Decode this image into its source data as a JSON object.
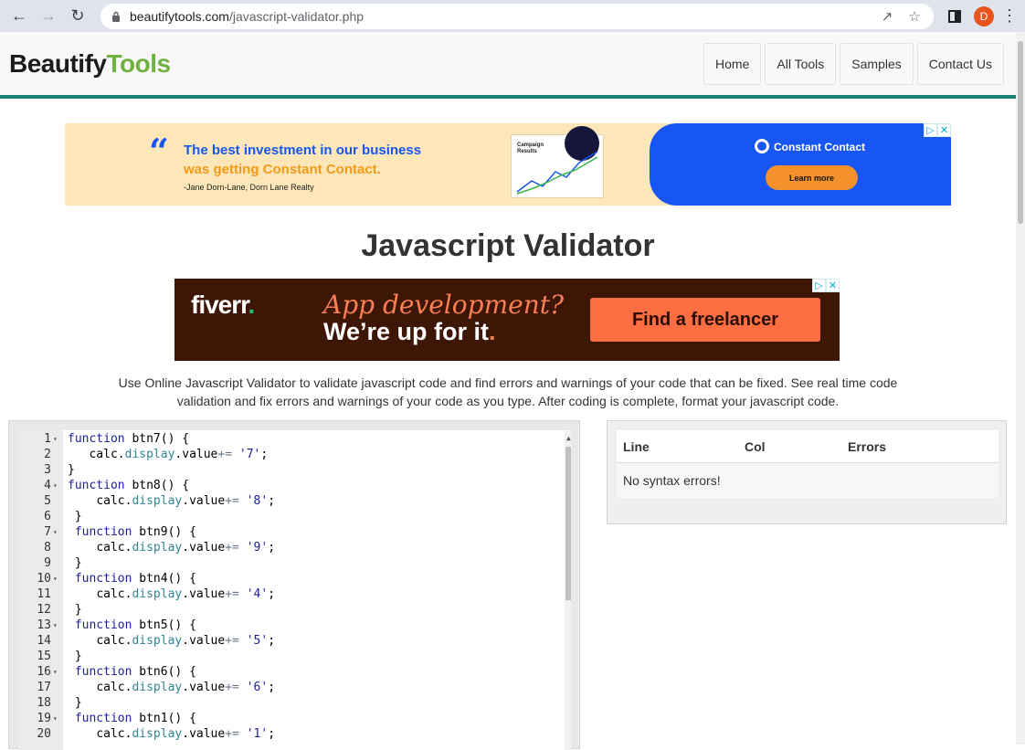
{
  "browser": {
    "url_host": "beautifytools.com",
    "url_path": "/javascript-validator.php",
    "avatar_letter": "D"
  },
  "site": {
    "logo_part1": "Beautify",
    "logo_part2": "Tools",
    "nav": [
      "Home",
      "All Tools",
      "Samples",
      "Contact Us"
    ]
  },
  "ad1": {
    "quote_mark": "“",
    "line1": "The best investment in our business",
    "line2": "was getting Constant Contact.",
    "cite": "-Jane Dorn-Lane, Dorn Lane Realty",
    "card_title": "Campaign Results",
    "brand": "Constant Contact",
    "cta": "Learn more"
  },
  "page": {
    "title": "Javascript Validator",
    "description": "Use Online Javascript Validator to validate javascript code and find errors and warnings of your code that can be fixed. See real time code validation and fix errors and warnings of your code as you type. After coding is complete, format your javascript code."
  },
  "ad2": {
    "brand": "fiverr",
    "brand_dot": ".",
    "line1": "App development?",
    "line2": "We’re up for it",
    "line2_dot": ".",
    "cta": "Find a freelancer"
  },
  "editor": {
    "lines": [
      {
        "n": "1",
        "fold": true,
        "indent": "",
        "kind": "fn",
        "name": "btn7"
      },
      {
        "n": "2",
        "fold": false,
        "indent": "   ",
        "kind": "body",
        "digit": "'7'"
      },
      {
        "n": "3",
        "fold": false,
        "indent": "",
        "kind": "close"
      },
      {
        "n": "4",
        "fold": true,
        "indent": "",
        "kind": "fn",
        "name": "btn8"
      },
      {
        "n": "5",
        "fold": false,
        "indent": "    ",
        "kind": "body",
        "digit": "'8'"
      },
      {
        "n": "6",
        "fold": false,
        "indent": " ",
        "kind": "close"
      },
      {
        "n": "7",
        "fold": true,
        "indent": " ",
        "kind": "fn",
        "name": "btn9"
      },
      {
        "n": "8",
        "fold": false,
        "indent": "    ",
        "kind": "body",
        "digit": "'9'"
      },
      {
        "n": "9",
        "fold": false,
        "indent": " ",
        "kind": "close"
      },
      {
        "n": "10",
        "fold": true,
        "indent": " ",
        "kind": "fn",
        "name": "btn4"
      },
      {
        "n": "11",
        "fold": false,
        "indent": "    ",
        "kind": "body",
        "digit": "'4'"
      },
      {
        "n": "12",
        "fold": false,
        "indent": " ",
        "kind": "close"
      },
      {
        "n": "13",
        "fold": true,
        "indent": " ",
        "kind": "fn",
        "name": "btn5"
      },
      {
        "n": "14",
        "fold": false,
        "indent": "    ",
        "kind": "body",
        "digit": "'5'"
      },
      {
        "n": "15",
        "fold": false,
        "indent": " ",
        "kind": "close"
      },
      {
        "n": "16",
        "fold": true,
        "indent": " ",
        "kind": "fn",
        "name": "btn6"
      },
      {
        "n": "17",
        "fold": false,
        "indent": "    ",
        "kind": "body",
        "digit": "'6'"
      },
      {
        "n": "18",
        "fold": false,
        "indent": " ",
        "kind": "close"
      },
      {
        "n": "19",
        "fold": true,
        "indent": " ",
        "kind": "fn",
        "name": "btn1"
      },
      {
        "n": "20",
        "fold": false,
        "indent": "    ",
        "kind": "body",
        "digit": "'1'"
      }
    ],
    "tokens": {
      "function": "function",
      "paren": "() {",
      "obj": "calc.",
      "prop": "display",
      "value": ".value",
      "op": "+=",
      "semi": ";",
      "close": "}"
    }
  },
  "errors": {
    "headers": [
      "Line",
      "Col",
      "Errors"
    ],
    "message": "No syntax errors!"
  }
}
